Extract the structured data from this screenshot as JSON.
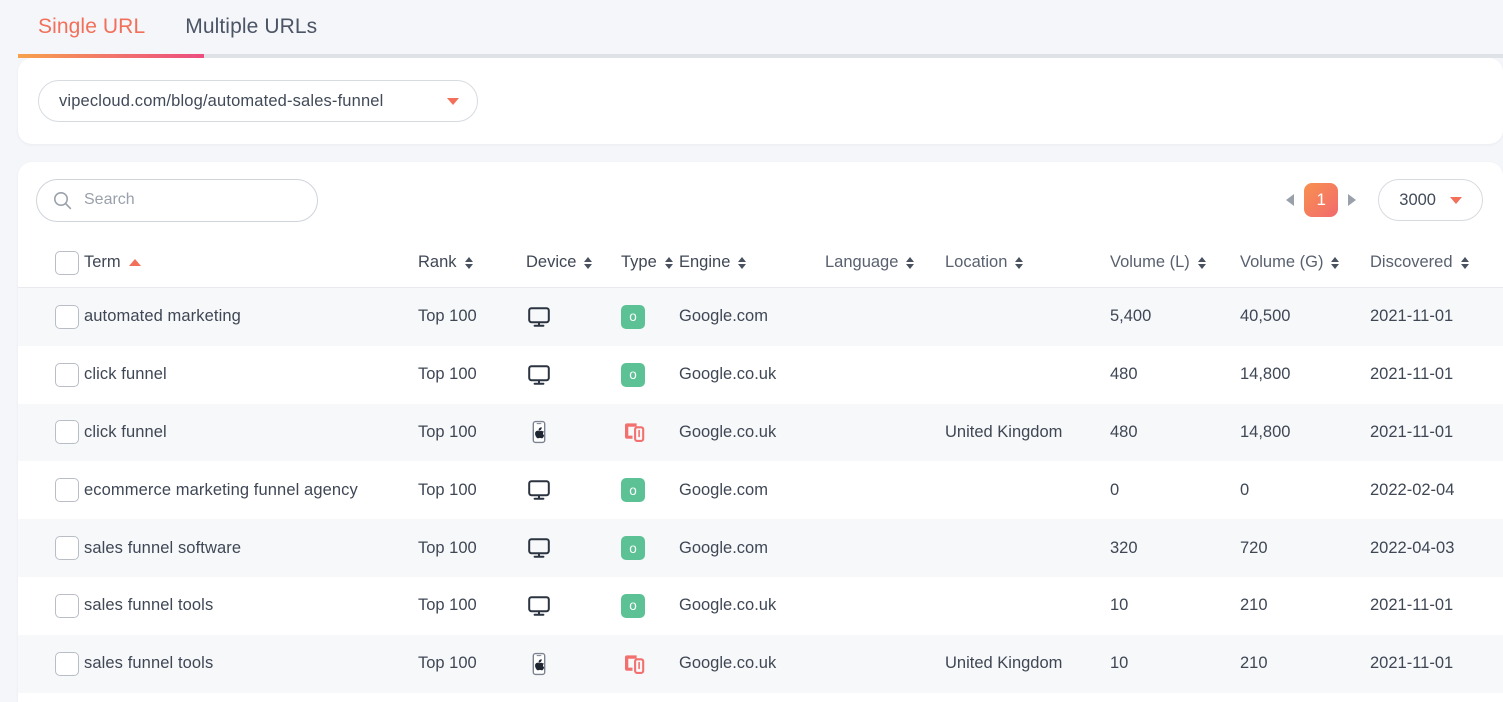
{
  "tabs": [
    {
      "label": "Single URL",
      "active": true
    },
    {
      "label": "Multiple URLs",
      "active": false
    }
  ],
  "url_selector": {
    "value": "vipecloud.com/blog/automated-sales-funnel",
    "caret_icon": "caret-down-icon"
  },
  "toolbar": {
    "search": {
      "placeholder": "Search",
      "value": "",
      "icon": "search-icon"
    },
    "pagination": {
      "prev_icon": "caret-left-icon",
      "next_icon": "caret-right-icon",
      "current_page": "1"
    },
    "page_size": {
      "value": "3000",
      "caret_icon": "caret-down-icon"
    }
  },
  "table": {
    "select_all_checkbox": false,
    "columns": [
      {
        "label": "Term",
        "sort": "asc"
      },
      {
        "label": "Rank",
        "sort": "none"
      },
      {
        "label": "Device",
        "sort": "none"
      },
      {
        "label": "Type",
        "sort": "none"
      },
      {
        "label": "Engine",
        "sort": "none"
      },
      {
        "label": "Language",
        "sort": "none"
      },
      {
        "label": "Location",
        "sort": "none"
      },
      {
        "label": "Volume (L)",
        "sort": "none"
      },
      {
        "label": "Volume (G)",
        "sort": "none"
      },
      {
        "label": "Discovered",
        "sort": "none"
      }
    ],
    "rows": [
      {
        "term": "automated marketing",
        "rank": "Top 100",
        "device_icon": "desktop-monitor-icon",
        "type_icon": "organic-badge-icon",
        "type_label": "o",
        "engine": "Google.com",
        "language": "",
        "location": "",
        "volume_l": "5,400",
        "volume_g": "40,500",
        "discovered": "2021-11-01"
      },
      {
        "term": "click funnel",
        "rank": "Top 100",
        "device_icon": "desktop-monitor-icon",
        "type_icon": "organic-badge-icon",
        "type_label": "o",
        "engine": "Google.co.uk",
        "language": "",
        "location": "",
        "volume_l": "480",
        "volume_g": "14,800",
        "discovered": "2021-11-01"
      },
      {
        "term": "click funnel",
        "rank": "Top 100",
        "device_icon": "iphone-mobile-icon",
        "type_icon": "responsive-devices-icon",
        "type_label": "",
        "engine": "Google.co.uk",
        "language": "",
        "location": "United Kingdom",
        "volume_l": "480",
        "volume_g": "14,800",
        "discovered": "2021-11-01"
      },
      {
        "term": "ecommerce marketing funnel agency",
        "rank": "Top 100",
        "device_icon": "desktop-monitor-icon",
        "type_icon": "organic-badge-icon",
        "type_label": "o",
        "engine": "Google.com",
        "language": "",
        "location": "",
        "volume_l": "0",
        "volume_g": "0",
        "discovered": "2022-02-04"
      },
      {
        "term": "sales funnel software",
        "rank": "Top 100",
        "device_icon": "desktop-monitor-icon",
        "type_icon": "organic-badge-icon",
        "type_label": "o",
        "engine": "Google.com",
        "language": "",
        "location": "",
        "volume_l": "320",
        "volume_g": "720",
        "discovered": "2022-04-03"
      },
      {
        "term": "sales funnel tools",
        "rank": "Top 100",
        "device_icon": "desktop-monitor-icon",
        "type_icon": "organic-badge-icon",
        "type_label": "o",
        "engine": "Google.co.uk",
        "language": "",
        "location": "",
        "volume_l": "10",
        "volume_g": "210",
        "discovered": "2021-11-01"
      },
      {
        "term": "sales funnel tools",
        "rank": "Top 100",
        "device_icon": "iphone-mobile-icon",
        "type_icon": "responsive-devices-icon",
        "type_label": "",
        "engine": "Google.co.uk",
        "language": "",
        "location": "United Kingdom",
        "volume_l": "10",
        "volume_g": "210",
        "discovered": "2021-11-01"
      }
    ]
  },
  "colors": {
    "accent": "#f2705a",
    "accent_gradient_start": "#f8914f",
    "accent_gradient_end": "#ec4d7e",
    "organic_green": "#5cc295",
    "responsive_red": "#f2706e",
    "page_bg": "#f4f6fa",
    "row_alt_bg": "#f7f8fa"
  }
}
